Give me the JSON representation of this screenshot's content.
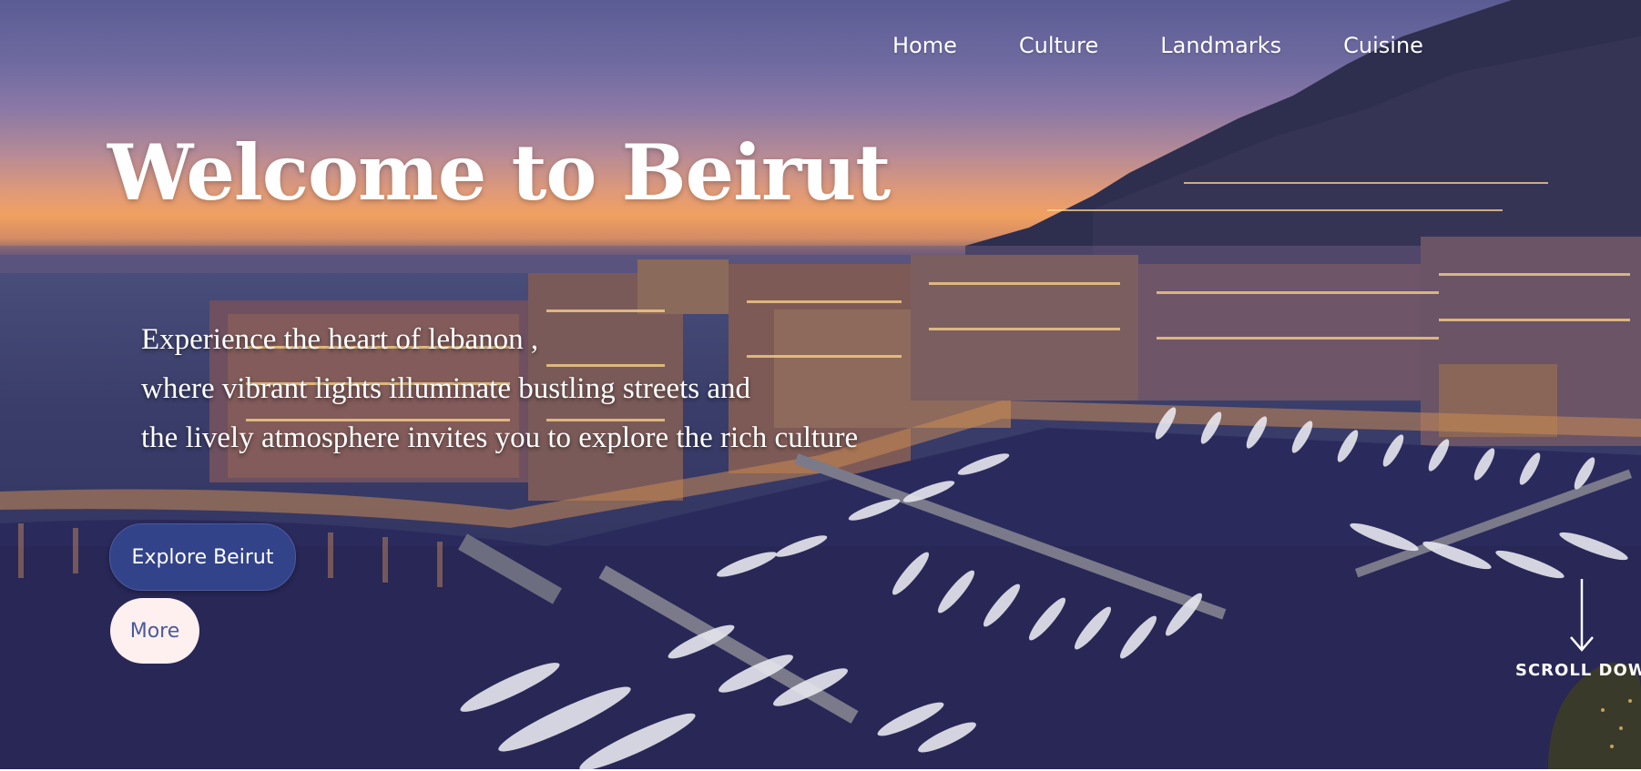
{
  "nav": {
    "items": [
      {
        "label": "Home"
      },
      {
        "label": "Culture"
      },
      {
        "label": "Landmarks"
      },
      {
        "label": "Cuisine"
      }
    ]
  },
  "hero": {
    "title": "Welcome to Beirut",
    "tagline": [
      "Experience the heart of lebanon ,",
      "where vibrant lights illuminate bustling streets and",
      "the lively atmosphere invites you to explore the rich culture"
    ],
    "primary_button": "Explore Beirut",
    "secondary_button": "More",
    "scroll_label": "SCROLL DOW",
    "scroll_icon": "arrow-down-icon"
  },
  "colors": {
    "primary_button_bg": "#32438a",
    "secondary_button_bg": "#fdf0ef",
    "secondary_button_text": "#4a5a9c"
  }
}
